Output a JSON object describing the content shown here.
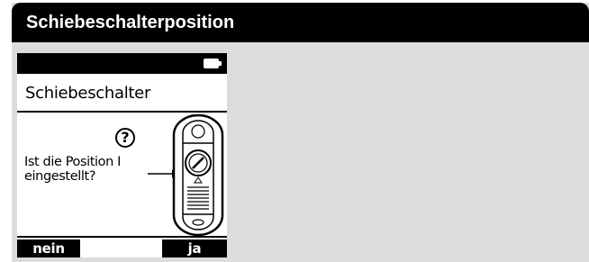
{
  "header": {
    "title": "Schiebeschalterposition"
  },
  "device": {
    "status": {
      "battery_icon": "battery-icon"
    },
    "screen_title": "Schiebeschalter",
    "help_icon": "question-circle-icon",
    "question_lines": [
      "Ist die Position I",
      "eingestellt?"
    ],
    "illustration_icon": "slide-switch-icon",
    "softkeys": {
      "left": "nein",
      "right": "ja"
    }
  },
  "colors": {
    "panel_bg": "#dcdcdc",
    "title_bg": "#000000",
    "title_fg": "#ffffff"
  }
}
